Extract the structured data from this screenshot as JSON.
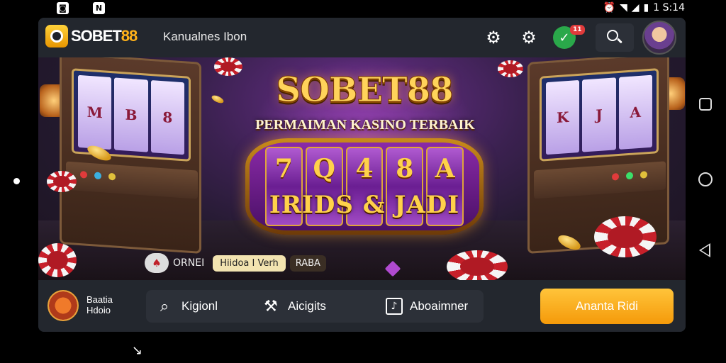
{
  "status_bar": {
    "left_icons": [
      "notification-app-icon",
      "notification-app-icon-2"
    ],
    "left_icon_glyphs": [
      "◙",
      "N"
    ],
    "time": "1 S:14",
    "right_icons": [
      "alarm-icon",
      "wifi-icon",
      "signal-icon",
      "battery-icon"
    ]
  },
  "header": {
    "logo_text_white": "SOBET",
    "logo_text_accent": "88",
    "title": "Kanualnes Ibon",
    "promo_badge": "11",
    "accent_color": "#ffb21a"
  },
  "hero": {
    "title": "SOBET88",
    "subtitle": "PERMAIMAN KASINO TERBAIK",
    "reel_symbols": [
      "7",
      "Q",
      "4",
      "8",
      "A"
    ],
    "reel_caption": "IRIDS & JADI",
    "ticker": {
      "icon_text": "♠",
      "text": "ORNEI",
      "pill": "Hiidoa I Verh",
      "pill2": "RABA"
    },
    "left_machine_reels": [
      "M",
      "B",
      "8"
    ],
    "right_machine_reels": [
      "K",
      "J",
      "A"
    ]
  },
  "bottom_bar": {
    "profile_line1": "Baatia",
    "profile_line2": "Hdoio",
    "segments": [
      {
        "icon": "search-icon",
        "glyph": "⌕",
        "label": "Kigionl"
      },
      {
        "icon": "tools-icon",
        "glyph": "⚒",
        "label": "Aicigits"
      },
      {
        "icon": "music-note-icon",
        "glyph": "♪",
        "label": "Aboaimner"
      }
    ],
    "cta_label": "Ananta Ridi",
    "cta_color": "#f59a0a"
  },
  "nav": {
    "below_glyph": "↘"
  }
}
